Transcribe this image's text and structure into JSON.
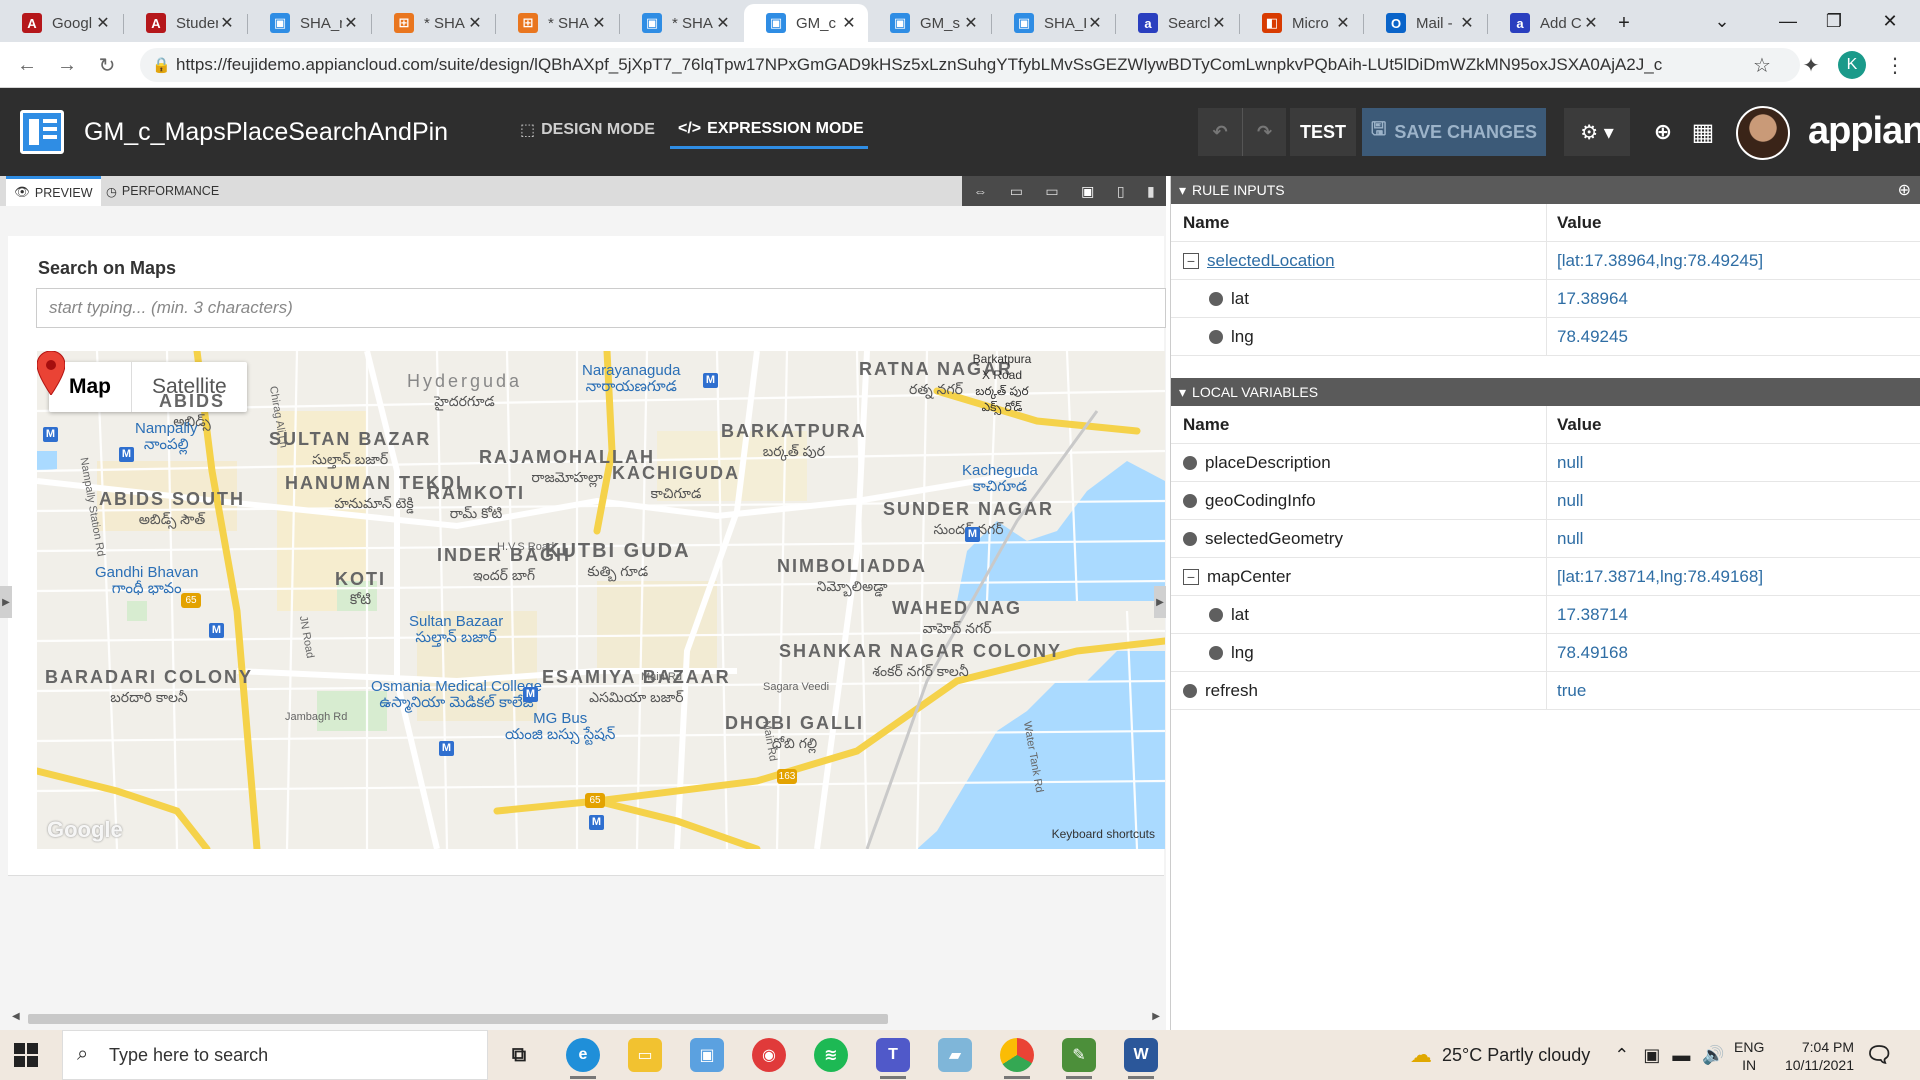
{
  "browser": {
    "tabs": [
      {
        "title": "Googl",
        "icon": "A",
        "color": "#b5171b"
      },
      {
        "title": "Studer",
        "icon": "A",
        "color": "#b5171b"
      },
      {
        "title": "SHA_r",
        "icon": "▣",
        "color": "#2f8de4"
      },
      {
        "title": "* SHA",
        "icon": "⊞",
        "color": "#e9761f"
      },
      {
        "title": "* SHA",
        "icon": "⊞",
        "color": "#e9761f"
      },
      {
        "title": "* SHA",
        "icon": "▣",
        "color": "#2f8de4"
      },
      {
        "title": "GM_c",
        "icon": "▣",
        "color": "#2f8de4"
      },
      {
        "title": "GM_s",
        "icon": "▣",
        "color": "#2f8de4"
      },
      {
        "title": "SHA_I",
        "icon": "▣",
        "color": "#2f8de4"
      },
      {
        "title": "Searcl",
        "icon": "a",
        "color": "#2a3fbf"
      },
      {
        "title": "Micro",
        "icon": "◧",
        "color": "#d83b01"
      },
      {
        "title": "Mail -",
        "icon": "O",
        "color": "#0a64c9"
      },
      {
        "title": "Add C",
        "icon": "a",
        "color": "#2a3fbf"
      }
    ],
    "url": "https://feujidemo.appiancloud.com/suite/design/lQBhAXpf_5jXpT7_76lqTpw17NPxGmGAD9kHSz5xLznSuhgYTfybLMvSsGEZWlywBDTyComLwnpkvPQbAih-LUt5lDiDmWZkMN95oxJSXA0AjA2J_c",
    "profile_initial": "K"
  },
  "header": {
    "title": "GM_c_MapsPlaceSearchAndPin",
    "design_mode": "DESIGN MODE",
    "expression_mode": "EXPRESSION MODE",
    "test": "TEST",
    "save": "SAVE CHANGES",
    "brand": "appian"
  },
  "preview": {
    "tab_preview": "PREVIEW",
    "tab_performance": "PERFORMANCE",
    "search_label": "Search on Maps",
    "search_placeholder": "start typing... (min. 3 characters)",
    "map_button": "Map",
    "satellite_button": "Satellite",
    "keyboard_shortcuts": "Keyboard shortcuts",
    "google": "Google",
    "areas": [
      {
        "en": "SULTAN BAZAR",
        "te": "సుల్తాన్ బజార్"
      },
      {
        "en": "HANUMAN TEKDI",
        "te": "హనుమాన్ టెక్డి"
      },
      {
        "en": "RAMKOTI",
        "te": "రామ్ కోటి"
      },
      {
        "en": "RAJAMOHALLAH",
        "te": "రాజమోహల్లా"
      },
      {
        "en": "KACHIGUDA",
        "te": "కాచిగూడ"
      },
      {
        "en": "BARKATPURA",
        "te": "బర్కత్ పుర"
      },
      {
        "en": "RATNA NAGAR",
        "te": "రత్న నగర్"
      },
      {
        "en": "SUNDER NAGAR",
        "te": "సుందర్ నగర్"
      },
      {
        "en": "KUTBI GUDA",
        "te": "కుత్బి గూడ"
      },
      {
        "en": "INDER BAGH",
        "te": "ఇందర్ బాగ్"
      },
      {
        "en": "KOTI",
        "te": "కోటి"
      },
      {
        "en": "ABIDS SOUTH",
        "te": "అబిడ్స్ సౌత్"
      },
      {
        "en": "NIMBOLIADDA",
        "te": "నిమ్బోలిఅడ్డా"
      },
      {
        "en": "WAHED NAG",
        "te": "వాహెద్ నగర్"
      },
      {
        "en": "SHANKAR NAGAR COLONY",
        "te": "శంకర్ నగర్ కాలనీ"
      },
      {
        "en": "ESAMIYA BAZAAR",
        "te": "ఎసమియా బజార్"
      },
      {
        "en": "DHOBI GALLI",
        "te": "ధోబి గల్లి"
      },
      {
        "en": "BARADARI COLONY",
        "te": "బరదారి కాలనీ"
      },
      {
        "en": "Hyderguda",
        "te": "హైదరగూడ"
      },
      {
        "en": "ABIDS",
        "te": "అబిడ్స్"
      }
    ],
    "pois": [
      {
        "en": "Narayanaguda",
        "te": "నారాయణగూడ"
      },
      {
        "en": "Nampally",
        "te": "నాంపల్లి"
      },
      {
        "en": "Kacheguda",
        "te": "కాచిగూడ"
      },
      {
        "en": "Gandhi Bhavan",
        "te": "గాంధీ భావం"
      },
      {
        "en": "Sultan Bazaar",
        "te": "సుల్తాన్ బజార్"
      },
      {
        "en": "Osmania Medical College",
        "te": "ఉస్మానియా మెడికల్ కాలేజ్"
      },
      {
        "en": "MG Bus",
        "te": "యంజి బస్సు స్టేషన్"
      },
      {
        "en": "Barkatpura X Road",
        "te": "బర్కత్ పుర ఎక్స్ రోడ్"
      }
    ],
    "roads": [
      "Main Rd",
      "Jambagh Rd",
      "JN Road",
      "Chirag Ali Ln",
      "Nampally Station Rd",
      "H.V.S Road",
      "Sagara Veedi",
      "Water Tank Rd",
      "Main Rd"
    ],
    "shields": [
      "65",
      "65",
      "163"
    ]
  },
  "rule_inputs": {
    "header": "RULE INPUTS",
    "col_name": "Name",
    "col_value": "Value",
    "rows": [
      {
        "name": "selectedLocation",
        "value": "[lat:17.38964,lng:78.49245]",
        "kind": "parent"
      },
      {
        "name": "lat",
        "value": "17.38964",
        "kind": "child"
      },
      {
        "name": "lng",
        "value": "78.49245",
        "kind": "child"
      }
    ]
  },
  "local_variables": {
    "header": "LOCAL VARIABLES",
    "col_name": "Name",
    "col_value": "Value",
    "rows": [
      {
        "name": "placeDescription",
        "value": "null",
        "kind": "leaf"
      },
      {
        "name": "geoCodingInfo",
        "value": "null",
        "kind": "leaf"
      },
      {
        "name": "selectedGeometry",
        "value": "null",
        "kind": "leaf"
      },
      {
        "name": "mapCenter",
        "value": "[lat:17.38714,lng:78.49168]",
        "kind": "parent"
      },
      {
        "name": "lat",
        "value": "17.38714",
        "kind": "child"
      },
      {
        "name": "lng",
        "value": "78.49168",
        "kind": "child"
      },
      {
        "name": "refresh",
        "value": "true",
        "kind": "leaf"
      }
    ]
  },
  "taskbar": {
    "search_placeholder": "Type here to search",
    "weather": "25°C  Partly cloudy",
    "lang1": "ENG",
    "lang2": "IN",
    "time": "7:04 PM",
    "date": "10/11/2021"
  }
}
